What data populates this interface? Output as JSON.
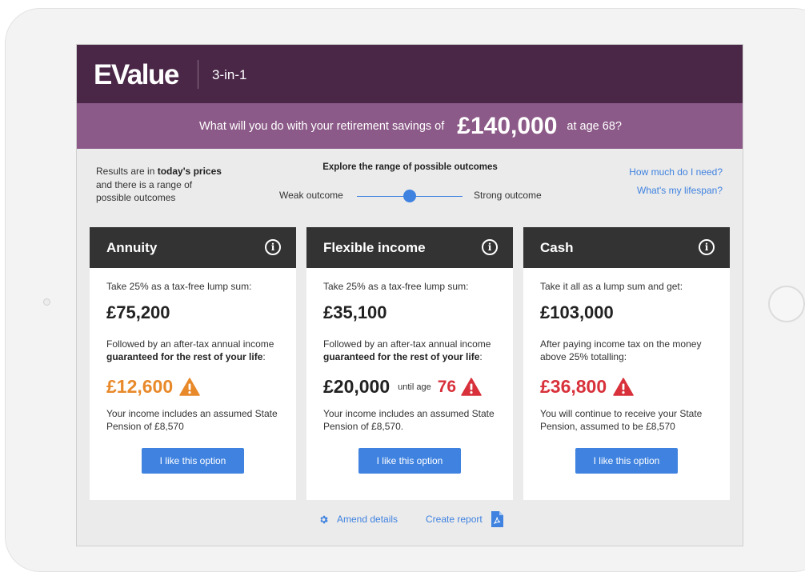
{
  "header": {
    "logo": "EValue",
    "subtitle": "3-in-1"
  },
  "banner": {
    "question": "What will you do with your retirement savings of",
    "amount": "£140,000",
    "age_text": "at age 68?"
  },
  "results_note": {
    "prefix": "Results are in ",
    "bold": "today's prices",
    "suffix": " and there is a range of possible outcomes"
  },
  "explore": {
    "title": "Explore the range of possible outcomes",
    "weak_label": "Weak outcome",
    "strong_label": "Strong outcome",
    "slider_position": 0.5
  },
  "links": {
    "how_much": "How much do I need?",
    "lifespan": "What's my lifespan?"
  },
  "cards": [
    {
      "title": "Annuity",
      "lump_label": "Take 25% as a tax-free lump sum:",
      "lump_value": "£75,200",
      "desc_prefix": "Followed by an after-tax annual income ",
      "desc_bold": "guaranteed for the rest of your life",
      "desc_suffix": ":",
      "income_value": "£12,600",
      "income_color": "orange",
      "footnote": "Your income includes an assumed State Pension of £8,570",
      "button": "I like this option"
    },
    {
      "title": "Flexible income",
      "lump_label": "Take 25% as a tax-free lump sum:",
      "lump_value": "£35,100",
      "desc_prefix": "Followed by an after-tax annual income ",
      "desc_bold": "guaranteed for the rest of your life",
      "desc_suffix": ":",
      "income_value": "£20,000",
      "until_age_label": "until age",
      "until_age_value": "76",
      "footnote": "Your income includes an assumed State Pension of £8,570.",
      "button": "I like this option"
    },
    {
      "title": "Cash",
      "lump_label": "Take it all as a lump sum and get:",
      "lump_value": "£103,000",
      "desc": "After paying income tax on the money above 25% totalling:",
      "income_value": "£36,800",
      "income_color": "red",
      "footnote": "You will continue to receive your State Pension, assumed to be £8,570",
      "button": "I like this option"
    }
  ],
  "footer": {
    "amend": "Amend details",
    "report": "Create report"
  },
  "colors": {
    "header_bg": "#4a2647",
    "banner_bg": "#8c5a88",
    "accent_blue": "#3f82e0",
    "warn_orange": "#e8892a",
    "warn_red": "#d8313b",
    "card_head": "#333333"
  },
  "icons": [
    "info-icon",
    "warning-triangle-icon",
    "gear-icon",
    "pdf-icon"
  ]
}
